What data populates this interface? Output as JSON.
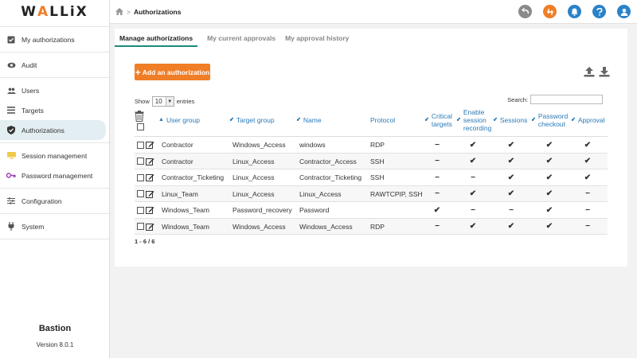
{
  "app": {
    "logo_prefix": "W",
    "logo_accent": "A",
    "logo_suffix": "LLiX",
    "product_name": "Bastion",
    "version": "Version 8.0.1",
    "accent_color": "#f07e26",
    "link_color": "#2a7ab8"
  },
  "sidebar": {
    "items": [
      {
        "label": "My authorizations",
        "icon": "checkbox-icon"
      },
      {
        "label": "Audit",
        "icon": "eye-icon"
      },
      {
        "label": "Users",
        "icon": "users-icon"
      },
      {
        "label": "Targets",
        "icon": "list-icon"
      },
      {
        "label": "Authorizations",
        "icon": "shield-check-icon",
        "active": true
      },
      {
        "label": "Session management",
        "icon": "monitor-icon"
      },
      {
        "label": "Password management",
        "icon": "key-icon"
      },
      {
        "label": "Configuration",
        "icon": "sliders-icon"
      },
      {
        "label": "System",
        "icon": "plug-icon"
      }
    ]
  },
  "header": {
    "breadcrumb_sep": ">",
    "breadcrumb_current": "Authorizations"
  },
  "tabs": [
    {
      "label": "Manage authorizations",
      "active": true
    },
    {
      "label": "My current approvals"
    },
    {
      "label": "My approval history"
    }
  ],
  "toolbar": {
    "add_label": "Add an authorization",
    "add_plus": "+"
  },
  "table_controls": {
    "show_label": "Show",
    "show_value": "10",
    "entries_label": "entries",
    "search_label": "Search:",
    "search_value": ""
  },
  "columns": [
    {
      "key": "user_group",
      "label": "User group"
    },
    {
      "key": "target_group",
      "label": "Target group"
    },
    {
      "key": "name",
      "label": "Name"
    },
    {
      "key": "protocol",
      "label": "Protocol"
    },
    {
      "key": "critical",
      "label": "Critical targets"
    },
    {
      "key": "recording",
      "label": "Enable session recording"
    },
    {
      "key": "sessions",
      "label": "Sessions"
    },
    {
      "key": "pwd_checkout",
      "label": "Password checkout"
    },
    {
      "key": "approval",
      "label": "Approval"
    }
  ],
  "rows": [
    {
      "user_group": "Contractor",
      "target_group": "Windows_Access",
      "name": "windows",
      "protocol": "RDP",
      "critical": "−",
      "recording": "✔",
      "sessions": "✔",
      "pwd_checkout": "✔",
      "approval": "✔"
    },
    {
      "user_group": "Contractor",
      "target_group": "Linux_Access",
      "name": "Contractor_Access",
      "protocol": "SSH",
      "critical": "−",
      "recording": "✔",
      "sessions": "✔",
      "pwd_checkout": "✔",
      "approval": "✔"
    },
    {
      "user_group": "Contractor_Ticketing",
      "target_group": "Linux_Access",
      "name": "Contractor_Ticketing",
      "protocol": "SSH",
      "critical": "−",
      "recording": "−",
      "sessions": "✔",
      "pwd_checkout": "✔",
      "approval": "✔"
    },
    {
      "user_group": "Linux_Team",
      "target_group": "Linux_Access",
      "name": "Linux_Access",
      "protocol": "RAWTCPIP, SSH",
      "critical": "−",
      "recording": "✔",
      "sessions": "✔",
      "pwd_checkout": "✔",
      "approval": "−"
    },
    {
      "user_group": "Windows_Team",
      "target_group": "Password_recovery",
      "name": "Password",
      "protocol": "",
      "critical": "✔",
      "recording": "−",
      "sessions": "−",
      "pwd_checkout": "✔",
      "approval": "−"
    },
    {
      "user_group": "Windows_Team",
      "target_group": "Windows_Access",
      "name": "Windows_Access",
      "protocol": "RDP",
      "critical": "−",
      "recording": "✔",
      "sessions": "✔",
      "pwd_checkout": "✔",
      "approval": "−"
    }
  ],
  "pager": {
    "info": "1 - 6 / 6"
  }
}
